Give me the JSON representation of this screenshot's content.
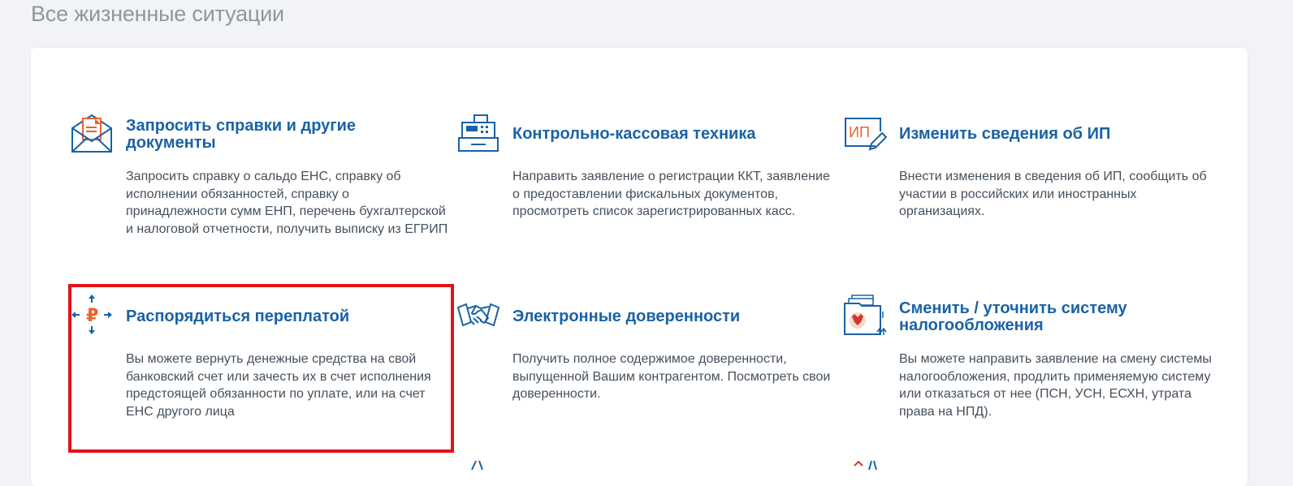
{
  "page": {
    "title": "Все жизненные ситуации"
  },
  "colors": {
    "accent": "#1a62a6",
    "highlight": "#e3121a",
    "icon_orange": "#e8642c"
  },
  "cards": [
    {
      "icon": "envelope-document-icon",
      "title": "Запросить справки и другие документы",
      "description": "Запросить справку о сальдо ЕНС, справку об исполнении обязанностей, справку о принадлежности сумм ЕНП, перечень бухгалтерской и налоговой отчетности, получить выписку из ЕГРИП"
    },
    {
      "icon": "cash-register-icon",
      "title": "Контрольно-кассовая техника",
      "description": "Направить заявление о регистрации ККТ, заявление о предоставлении фискальных документов, просмотреть список зарегистрированных касс."
    },
    {
      "icon": "ip-edit-icon",
      "icon_text": "ИП",
      "title": "Изменить сведения об ИП",
      "description": "Внести изменения в сведения об ИП, сообщить об участии в российских или иностранных организациях."
    },
    {
      "icon": "ruble-arrows-icon",
      "icon_text": "₽",
      "title": "Распорядиться переплатой",
      "description": "Вы можете вернуть денежные средства на свой банковский счет или зачесть их в счет исполнения предстоящей обязанности по уплате, или на счет ЕНС другого лица"
    },
    {
      "icon": "handshake-icon",
      "title": "Электронные доверенности",
      "description": "Получить полное содержимое доверенности, выпущенной Вашим контрагентом. Посмотреть свои доверенности."
    },
    {
      "icon": "tax-system-folder-icon",
      "title": "Сменить / уточнить систему налогообложения",
      "description": "Вы можете направить заявление на смену системы налогообложения, продлить применяемую систему или отказаться от нее (ПСН, УСН, ЕСХН, утрата права на НПД)."
    }
  ]
}
